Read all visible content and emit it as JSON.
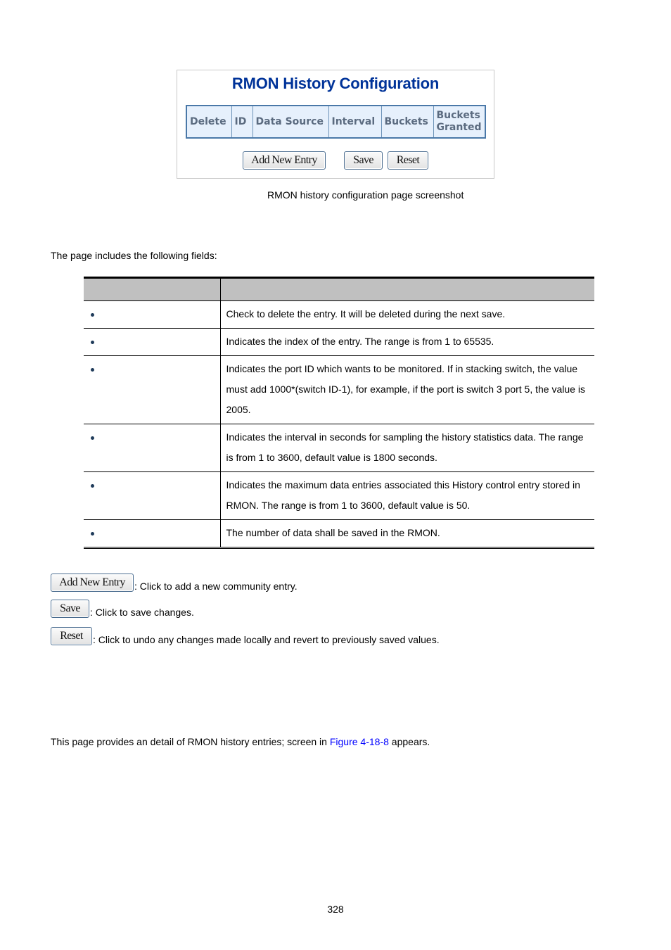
{
  "figure": {
    "title": "RMON History Configuration",
    "table_headers": [
      "Delete",
      "ID",
      "Data Source",
      "Interval",
      "Buckets",
      "Buckets Granted"
    ],
    "buttons": {
      "add_new_entry": "Add New Entry",
      "save": "Save",
      "reset": "Reset"
    },
    "caption": "RMON history configuration page screenshot"
  },
  "intro_text": "The page includes the following fields:",
  "fields_table": {
    "headers": [
      "",
      ""
    ],
    "rows": [
      {
        "object": "",
        "description": "Check to delete the entry. It will be deleted during the next save."
      },
      {
        "object": "",
        "description": "Indicates the index of the entry. The range is from 1 to 65535."
      },
      {
        "object": "",
        "description": "Indicates the port ID which wants to be monitored. If in stacking switch, the value must add 1000*(switch ID-1), for example, if the port is switch 3 port 5, the value is 2005."
      },
      {
        "object": "",
        "description": "Indicates the interval in seconds for sampling the history statistics data. The range is from 1 to 3600, default value is 1800 seconds."
      },
      {
        "object": "",
        "description": "Indicates the maximum data entries associated this History control entry stored in RMON. The range is from 1 to 3600, default value is 50."
      },
      {
        "object": "",
        "description": "The number of data shall be saved in the RMON."
      }
    ]
  },
  "buttons_section": [
    {
      "label": "Add New Entry",
      "description": ": Click to add a new community entry."
    },
    {
      "label": "Save",
      "description": ": Click to save changes."
    },
    {
      "label": "Reset",
      "description": ": Click to undo any changes made locally and revert to previously saved values."
    }
  ],
  "detail_text": {
    "before": "This page provides an detail of RMON history entries; screen in ",
    "link": "Figure 4-18-8",
    "after": " appears."
  },
  "colors": {
    "title_blue": "#003399",
    "link_blue": "#0000ff",
    "table_header_gray": "#c0c0c0",
    "screenshot_header_bg": "#e6f0fc"
  },
  "page_number": "328"
}
